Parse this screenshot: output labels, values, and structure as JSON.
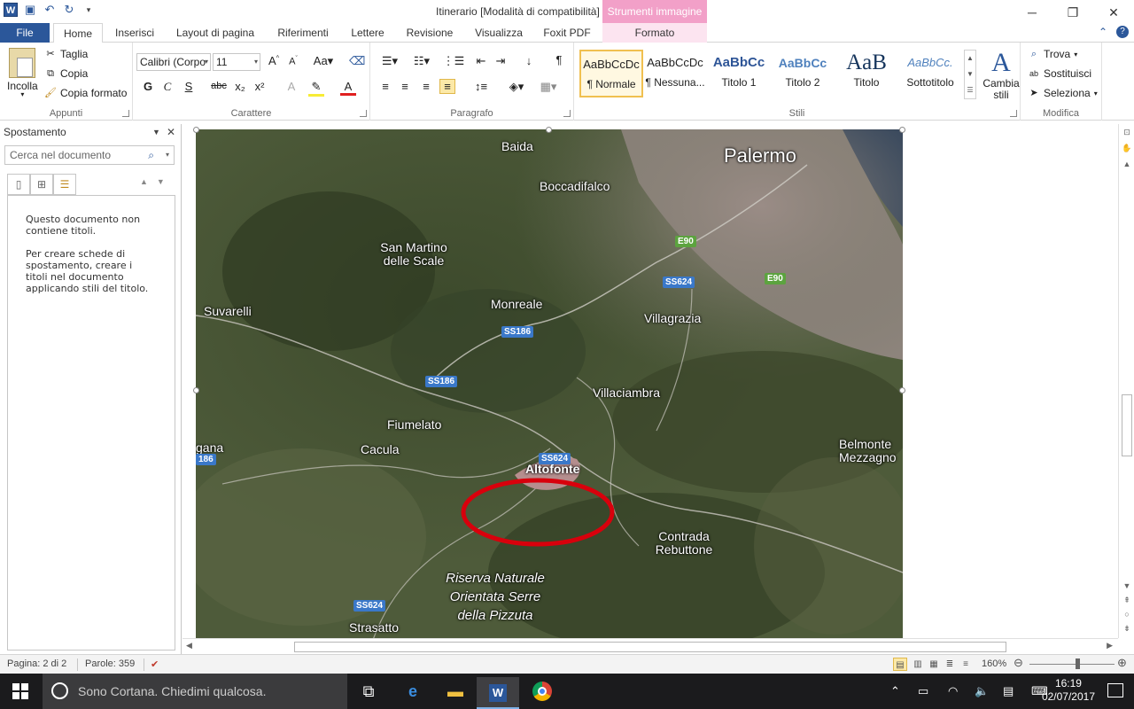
{
  "window": {
    "title": "Itinerario [Modalità di compatibilità]  -  Microsoft Word",
    "contextual_tab_group": "Strumenti immagine",
    "controls": {
      "minimize": "─",
      "restore": "❐",
      "close": "✕"
    }
  },
  "tabs": [
    "File",
    "Home",
    "Inserisci",
    "Layout di pagina",
    "Riferimenti",
    "Lettere",
    "Revisione",
    "Visualizza",
    "Foxit PDF",
    "Formato"
  ],
  "ribbon": {
    "clipboard": {
      "label": "Appunti",
      "paste": "Incolla",
      "cut": "Taglia",
      "copy": "Copia",
      "format_painter": "Copia formato"
    },
    "font": {
      "label": "Carattere",
      "font_name": "Calibri (Corpo",
      "font_size": "11",
      "bold": "G",
      "italic": "C",
      "underline": "S",
      "strikethrough": "abc",
      "subscript": "x₂",
      "superscript": "x²"
    },
    "paragraph": {
      "label": "Paragrafo"
    },
    "styles": {
      "label": "Stili",
      "items": [
        {
          "preview": "AaBbCcDc",
          "name": "¶ Normale"
        },
        {
          "preview": "AaBbCcDc",
          "name": "¶ Nessuna..."
        },
        {
          "preview": "AaBbCc",
          "name": "Titolo 1"
        },
        {
          "preview": "AaBbCc",
          "name": "Titolo 2"
        },
        {
          "preview": "AaB",
          "name": "Titolo"
        },
        {
          "preview": "AaBbCc.",
          "name": "Sottotitolo"
        }
      ],
      "change_styles": "Cambia stili"
    },
    "editing": {
      "label": "Modifica",
      "find": "Trova",
      "replace": "Sostituisci",
      "select": "Seleziona"
    }
  },
  "nav_pane": {
    "title": "Spostamento",
    "search_placeholder": "Cerca nel documento",
    "message_1": "Questo documento non contiene titoli.",
    "message_2": "Per creare schede di spostamento, creare i titoli nel documento applicando stili del titolo."
  },
  "map": {
    "labels": [
      "Palermo",
      "Baida",
      "Boccadifalco",
      "San Martino delle Scale",
      "Monreale",
      "Villagrazia",
      "Suvarelli",
      "Villaciambra",
      "Fiumelato",
      "Cacula",
      "Altofonte",
      "Belmonte Mezzagno",
      "Contrada Rebuttone",
      "Riserva Naturale Orientata Serre della Pizzuta",
      "Strasatto",
      "gana"
    ],
    "roads": [
      "E90",
      "E90",
      "SS624",
      "SS186",
      "SS186",
      "SS624",
      "SS624",
      "186"
    ],
    "colors": {
      "highlight_ring": "#d8000c",
      "road_blue": "#3a78c9",
      "road_green": "#5ca33f"
    }
  },
  "status": {
    "page": "Pagina: 2 di 2",
    "words": "Parole: 359",
    "zoom": "160%"
  },
  "taskbar": {
    "cortana": "Sono Cortana. Chiedimi qualcosa.",
    "time": "16:19",
    "date": "02/07/2017"
  },
  "colors": {
    "accent": "#2b579a",
    "contextual": "#f2a0c8"
  }
}
